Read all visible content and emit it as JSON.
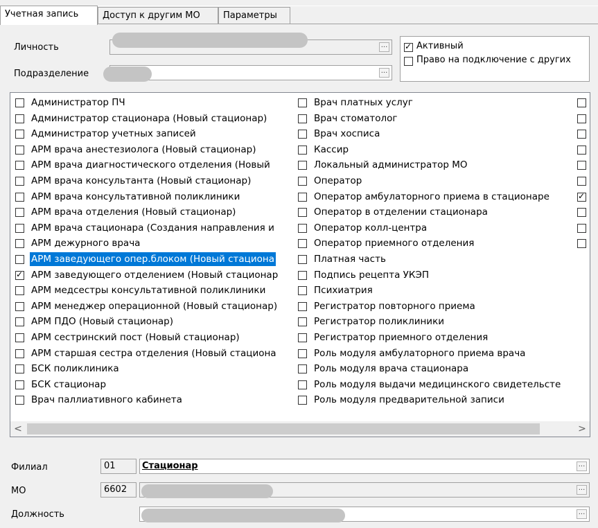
{
  "tabs": [
    "Учетная запись",
    "Доступ к другим МО",
    "Параметры"
  ],
  "person_label": "Личность",
  "department_label": "Подразделение",
  "ellipsis": "...",
  "active_label": "Активный",
  "right_connect_label": "Право на подключение с других",
  "roles_col1": [
    {
      "label": "Администратор ПЧ",
      "checked": false
    },
    {
      "label": "Администратор стационара (Новый стационар)",
      "checked": false
    },
    {
      "label": "Администратор учетных записей",
      "checked": false
    },
    {
      "label": "АРМ врача анестезиолога (Новый стационар)",
      "checked": false
    },
    {
      "label": "АРМ врача диагностического отделения (Новый",
      "checked": false
    },
    {
      "label": "АРМ врача консультанта (Новый стационар)",
      "checked": false
    },
    {
      "label": "АРМ врача консультативной поликлиники",
      "checked": false
    },
    {
      "label": "АРМ врача отделения (Новый стационар)",
      "checked": false
    },
    {
      "label": "АРМ врача стационара (Создания направления и",
      "checked": false
    },
    {
      "label": "АРМ дежурного врача",
      "checked": false
    },
    {
      "label": "АРМ заведующего опер.блоком (Новый стациона",
      "checked": false,
      "selected": true
    },
    {
      "label": "АРМ заведующего отделением (Новый стационар",
      "checked": true
    },
    {
      "label": "АРМ медсестры консультативной поликлиники",
      "checked": false
    },
    {
      "label": "АРМ менеджер операционной (Новый стационар)",
      "checked": false
    },
    {
      "label": "АРМ ПДО (Новый стационар)",
      "checked": false
    },
    {
      "label": "АРМ сестринский пост (Новый стационар)",
      "checked": false
    },
    {
      "label": "АРМ старшая сестра отделения (Новый стациона",
      "checked": false
    },
    {
      "label": "БСК поликлиника",
      "checked": false
    },
    {
      "label": "БСК стационар",
      "checked": false
    },
    {
      "label": "Врач паллиативного кабинета",
      "checked": false
    }
  ],
  "roles_col2": [
    {
      "label": "Врач платных услуг",
      "checked": false
    },
    {
      "label": "Врач стоматолог",
      "checked": false
    },
    {
      "label": "Врач хосписа",
      "checked": false
    },
    {
      "label": "Кассир",
      "checked": false
    },
    {
      "label": "Локальный администратор МО",
      "checked": false
    },
    {
      "label": "Оператор",
      "checked": false
    },
    {
      "label": "Оператор амбулаторного приема в стационаре",
      "checked": false
    },
    {
      "label": "Оператор в отделении стационара",
      "checked": false
    },
    {
      "label": "Оператор колл-центра",
      "checked": false
    },
    {
      "label": "Оператор приемного отделения",
      "checked": false
    },
    {
      "label": "Платная часть",
      "checked": false
    },
    {
      "label": "Подпись рецепта УКЭП",
      "checked": false
    },
    {
      "label": "Психиатрия",
      "checked": false
    },
    {
      "label": "Регистратор повторного приема",
      "checked": false
    },
    {
      "label": "Регистратор поликлиники",
      "checked": false
    },
    {
      "label": "Регистратор приемного отделения",
      "checked": false
    },
    {
      "label": "Роль модуля амбулаторного приема врача",
      "checked": false
    },
    {
      "label": "Роль модуля врача стационара",
      "checked": false
    },
    {
      "label": "Роль модуля выдачи медицинского свидетельсте",
      "checked": false
    },
    {
      "label": "Роль модуля предварительной записи",
      "checked": false
    }
  ],
  "roles_col3": [
    false,
    false,
    false,
    false,
    false,
    false,
    true,
    false,
    false,
    false
  ],
  "scroll_left": "<",
  "scroll_right": ">",
  "branch_label": "Филиал",
  "branch_code": "01",
  "branch_name": "Стационар",
  "mo_label": "МО",
  "mo_code": "6602",
  "position_label": "Должность"
}
